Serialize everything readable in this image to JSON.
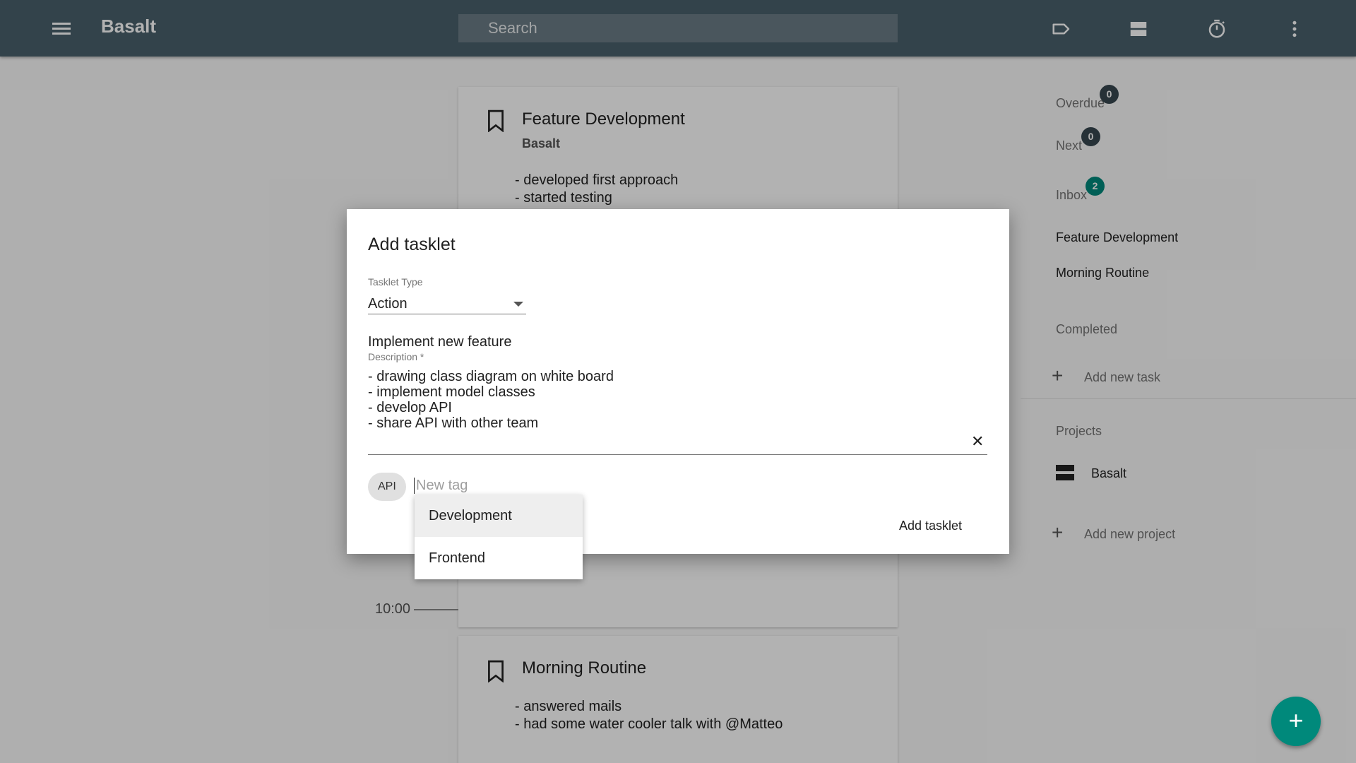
{
  "app": {
    "title": "Basalt"
  },
  "search": {
    "placeholder": "Search"
  },
  "topbar_icons": [
    "menu-icon",
    "label-icon",
    "view-agenda-icon",
    "timer-icon",
    "more-vert-icon"
  ],
  "timeline": {
    "cards": [
      {
        "title": "Feature Development",
        "project": "Basalt",
        "lines": [
          "- developed first approach",
          "- started testing"
        ]
      },
      {
        "title": "Morning Routine",
        "lines": [
          "- answered mails",
          "- had some water cooler talk with @Matteo"
        ]
      }
    ],
    "time_label": "10:00"
  },
  "sidebar": {
    "overdue": {
      "label": "Overdue",
      "count": "0"
    },
    "next": {
      "label": "Next",
      "count": "0"
    },
    "inbox": {
      "label": "Inbox",
      "count": "2"
    },
    "tasks": [
      "Feature Development",
      "Morning Routine"
    ],
    "completed": "Completed",
    "add_task": "Add new task",
    "projects_header": "Projects",
    "projects": [
      "Basalt"
    ],
    "add_project": "Add new project"
  },
  "dialog": {
    "title": "Add tasklet",
    "type_label": "Tasklet Type",
    "type_value": "Action",
    "title_value": "Implement new feature",
    "description_label": "Description *",
    "description_value": "- drawing class diagram on white board\n- implement model classes\n- develop API\n- share API with other team",
    "tags": [
      "API"
    ],
    "tag_placeholder": "New tag",
    "submit_label": "Add tasklet"
  },
  "autocomplete": {
    "options": [
      "Development",
      "Frontend"
    ],
    "highlighted": "Development"
  },
  "fab": {
    "label": "+"
  },
  "colors": {
    "toolbar": "#4a606c",
    "accent": "#00897b",
    "badge_dark": "#37474f"
  }
}
